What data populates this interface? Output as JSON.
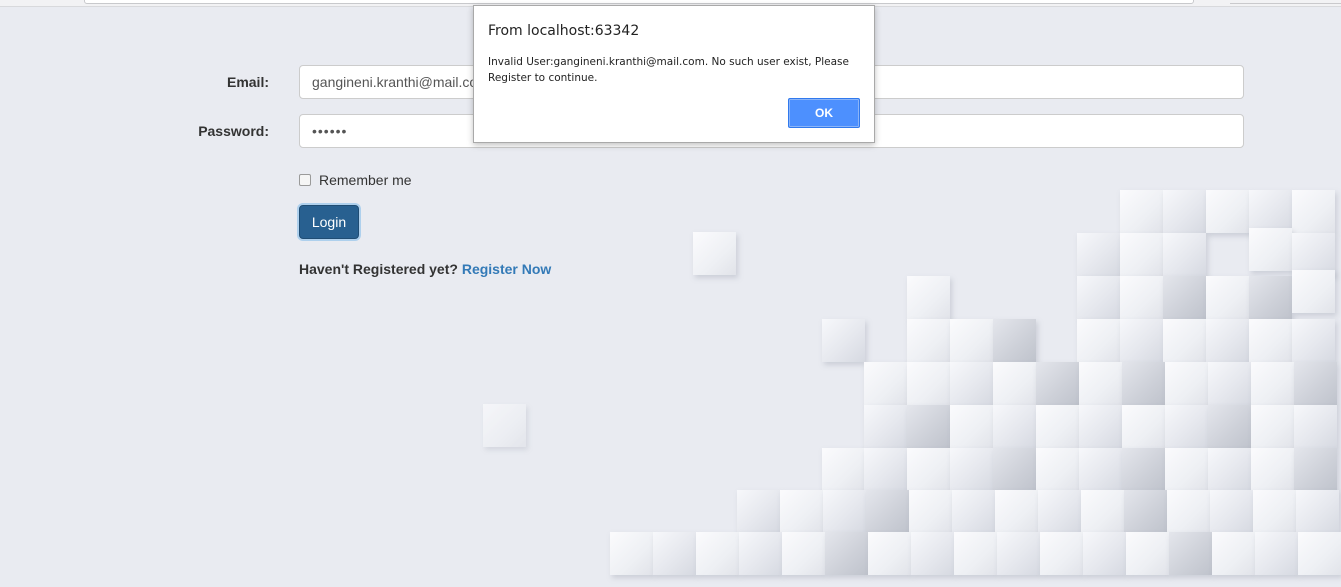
{
  "form": {
    "email_label": "Email:",
    "email_value": "gangineni.kranthi@mail.com",
    "password_label": "Password:",
    "password_value": "••••••",
    "remember_label": "Remember me",
    "remember_checked": false,
    "login_label": "Login",
    "register_prompt": "Haven't Registered yet?",
    "register_link": "Register Now"
  },
  "dialog": {
    "title": "From localhost:63342",
    "message": "Invalid User:gangineni.kranthi@mail.com. No such user exist, Please Register to continue.",
    "ok_label": "OK"
  },
  "colors": {
    "background": "#e9ebf1",
    "primary_button": "#286090",
    "link": "#337ab7",
    "dialog_ok": "#4d90fe"
  }
}
